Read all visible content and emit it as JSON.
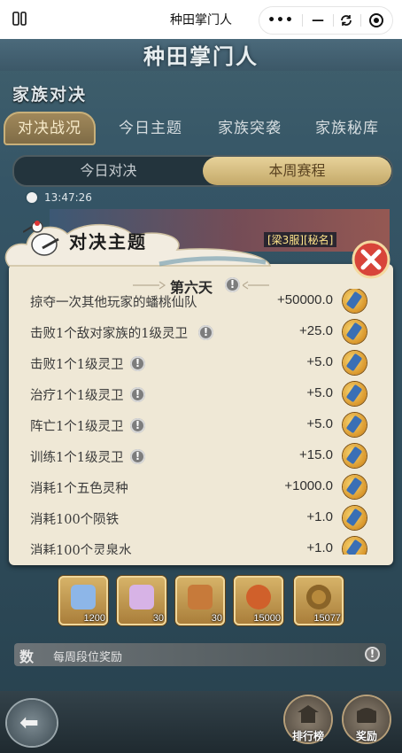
{
  "window": {
    "title": "种田掌门人",
    "capsule": {
      "more_label": "•••",
      "minimize_label": "—"
    }
  },
  "game": {
    "logo_text": "种田掌门人",
    "section_title": "家族对决",
    "tabs": [
      {
        "label": "对决战况",
        "active": true
      },
      {
        "label": "今日主题",
        "active": false
      },
      {
        "label": "家族突袭",
        "active": false
      },
      {
        "label": "家族秘库",
        "active": false
      }
    ],
    "subtabs": [
      {
        "label": "今日对决",
        "active": false
      },
      {
        "label": "本周赛程",
        "active": true
      }
    ],
    "timer": "13:47:26",
    "enemy_label": "[梁3服][秘名]"
  },
  "modal": {
    "title": "对决主题",
    "day": "第六天",
    "rows": [
      {
        "label": "掠夺一次其他玩家的蟠桃仙队",
        "value": "+50000.0",
        "info": false
      },
      {
        "label": "击败1个敌对家族的1级灵卫",
        "value": "+25.0",
        "info": true
      },
      {
        "label": "击败1个1级灵卫",
        "value": "+5.0",
        "info": true
      },
      {
        "label": "治疗1个1级灵卫",
        "value": "+5.0",
        "info": true
      },
      {
        "label": "阵亡1个1级灵卫",
        "value": "+5.0",
        "info": true
      },
      {
        "label": "训练1个1级灵卫",
        "value": "+15.0",
        "info": true
      },
      {
        "label": "消耗1个五色灵种",
        "value": "+1000.0",
        "info": false
      },
      {
        "label": "消耗100个陨铁",
        "value": "+1.0",
        "info": false
      },
      {
        "label": "消耗100个灵泉水",
        "value": "+1.0",
        "info": false
      }
    ]
  },
  "rewards": {
    "items": [
      {
        "count": "1200",
        "color": "#8db6e8"
      },
      {
        "count": "30",
        "color": "#d7b3e6"
      },
      {
        "count": "30",
        "color": "#c77a3a"
      },
      {
        "count": "15000",
        "color": "#d0602b"
      },
      {
        "count": "15077",
        "color": "#b88a3c"
      }
    ],
    "weekly_badge": "数",
    "weekly_label": "每周段位奖励"
  },
  "bottom": {
    "rank_label": "排行榜",
    "reward_label": "奖励"
  },
  "colors": {
    "panel_bg": "#efe8d6",
    "tab_active": "#a38a5c",
    "subtab_active": "#e7d29a",
    "close_red": "#d8443a"
  }
}
